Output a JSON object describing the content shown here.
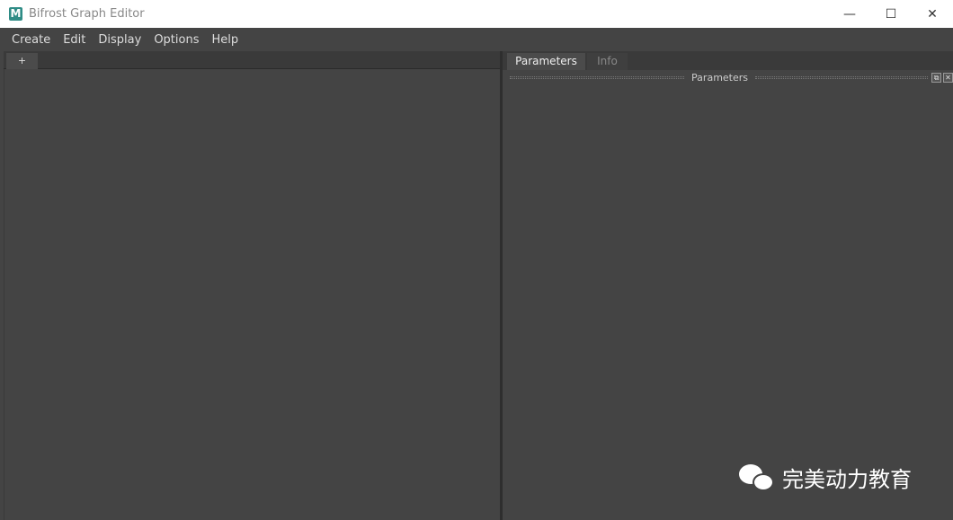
{
  "window": {
    "title": "Bifrost Graph Editor",
    "logo": "M",
    "minimize": "—",
    "maximize": "☐",
    "close": "✕"
  },
  "menu": [
    "Create",
    "Edit",
    "Display",
    "Options",
    "Help"
  ],
  "graph": {
    "add_tab": "+"
  },
  "right": {
    "tabs": [
      "Parameters",
      "Info"
    ],
    "section_title": "Parameters",
    "float_icon": "⧉",
    "close_icon": "✕"
  },
  "watermark": {
    "text": "完美动力教育"
  }
}
